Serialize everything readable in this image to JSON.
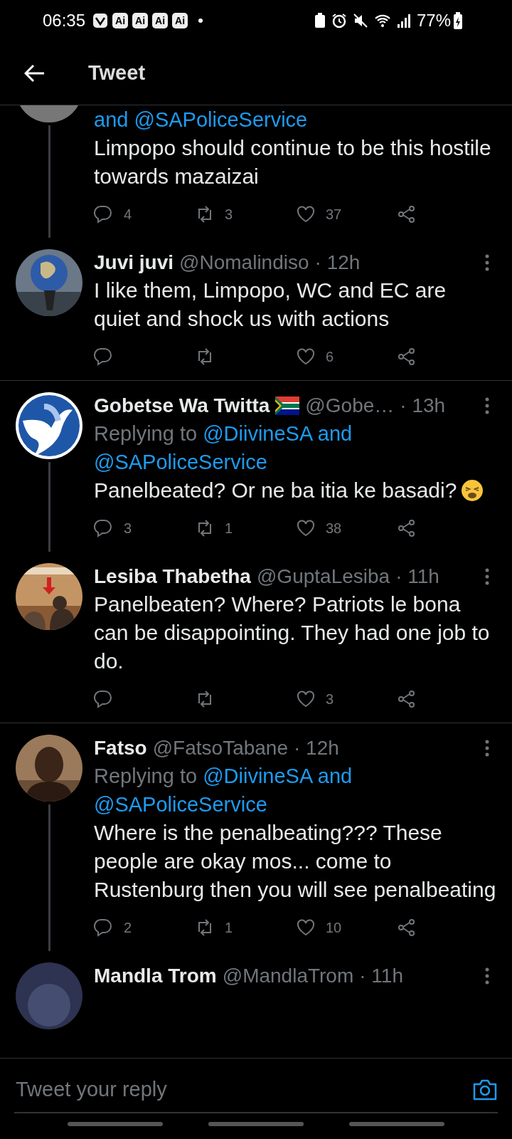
{
  "status_bar": {
    "time": "06:35",
    "notification_badges": [
      "Ai",
      "Ai",
      "Ai",
      "Ai"
    ],
    "battery": "77%"
  },
  "header": {
    "title": "Tweet"
  },
  "tweets": [
    {
      "replying_to": [
        "and @SAPoliceService"
      ],
      "text": "Limpopo should continue to be this hostile towards mazaizai",
      "replies": "4",
      "retweets": "3",
      "likes": "37",
      "thread_continues": true
    },
    {
      "name": "Juvi juvi",
      "handle": "@Nomalindiso",
      "time": "· 12h",
      "text": "I like them, Limpopo, WC and EC are quiet and shock us with actions",
      "likes": "6",
      "thread_continues": false
    },
    {
      "name": "Gobetse Wa Twitta",
      "handle": "@Gobe…",
      "time": "· 13h",
      "replying_prefix": "Replying to",
      "replying_to": [
        "@DiivineSA and",
        "@SAPoliceService"
      ],
      "text": "Panelbeated? Or ne ba itia ke basadi?",
      "replies": "3",
      "retweets": "1",
      "likes": "38",
      "thread_continues": true
    },
    {
      "name": "Lesiba Thabetha",
      "handle": "@GuptaLesiba",
      "time": "· 11h",
      "text": "Panelbeaten? Where? Patriots le bona can be disappointing. They had one job to do.",
      "likes": "3",
      "thread_continues": false
    },
    {
      "name": "Fatso",
      "handle": "@FatsoTabane",
      "time": "· 12h",
      "replying_prefix": "Replying to",
      "replying_to": [
        "@DiivineSA and",
        "@SAPoliceService"
      ],
      "text": "Where is the penalbeating??? These people are okay mos... come to Rustenburg then you will see penalbeating",
      "replies": "2",
      "retweets": "1",
      "likes": "10",
      "thread_continues": true
    },
    {
      "name": "Mandla Trom",
      "handle": "@MandlaTrom",
      "time": "· 11h"
    }
  ],
  "reply_bar": {
    "placeholder": "Tweet your reply"
  }
}
